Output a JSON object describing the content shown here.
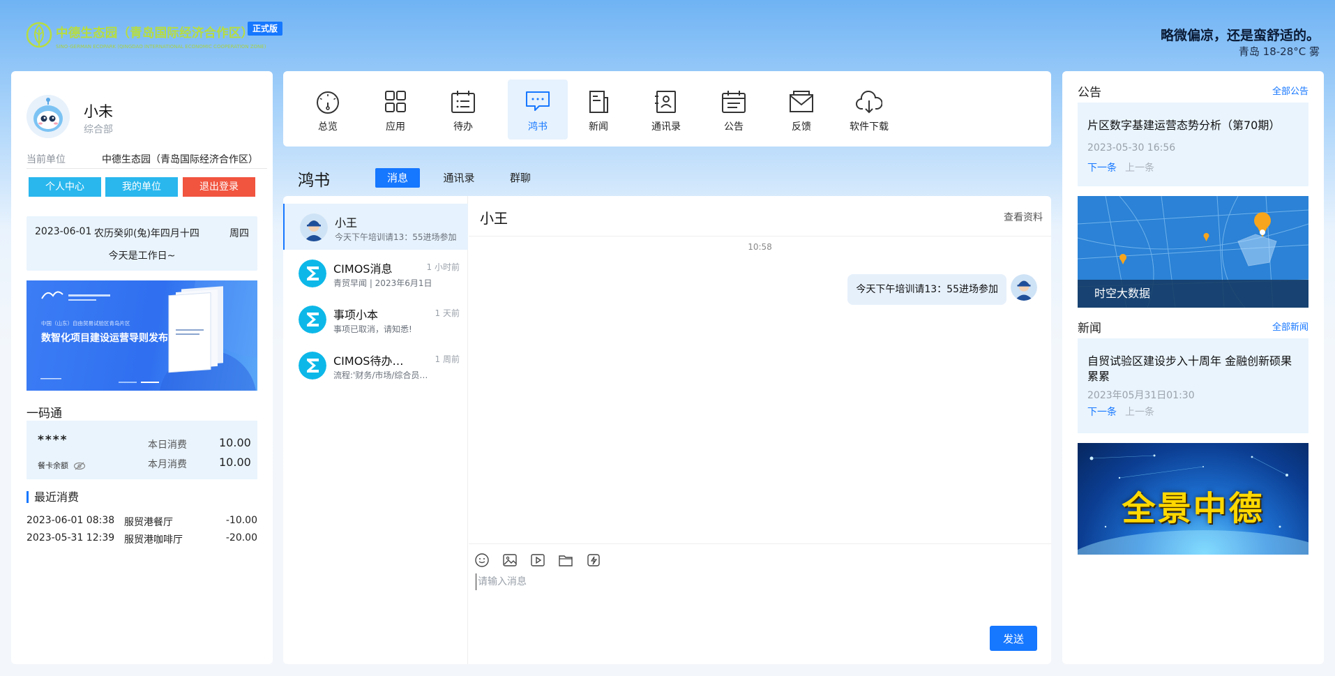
{
  "header": {
    "logo_title": "中德生态园（青岛国际经济合作区）",
    "logo_subtitle": "SINO-GERMAN ECOPARK (QINGDAO INTERNATIONAL ECONOMIC COOPERATION ZONE)",
    "version_badge": "正式版",
    "weather_text": "略微偏凉，还是蛮舒适的。",
    "weather_detail": "青岛 18-28°C 雾"
  },
  "profile": {
    "name": "小未",
    "department": "综合部",
    "unit_label": "当前单位",
    "unit_value": "中德生态园（青岛国际经济合作区）",
    "buttons": {
      "personal": "个人中心",
      "my_unit": "我的单位",
      "logout": "退出登录"
    }
  },
  "calendar": {
    "date": "2023-06-01",
    "lunar": "农历癸卯(兔)年四月十四",
    "weekday": "周四",
    "status": "今天是工作日~"
  },
  "banner": {
    "small_text": "中国（山东）自由贸易试验区青岛片区",
    "title": "数智化项目建设运营导则发布",
    "brand_color": "#2f6ff0"
  },
  "yimatong": {
    "title": "一码通",
    "card_mask": "****",
    "balance_label": "餐卡余额",
    "today_label": "本日消费",
    "today_value": "10.00",
    "month_label": "本月消费",
    "month_value": "10.00"
  },
  "recent": {
    "title": "最近消费",
    "items": [
      {
        "date": "2023-06-01 08:38",
        "merchant": "服贸港餐厅",
        "amount": "-10.00"
      },
      {
        "date": "2023-05-31 12:39",
        "merchant": "服贸港咖啡厅",
        "amount": "-20.00"
      }
    ]
  },
  "nav": {
    "items": [
      {
        "label": "总览",
        "icon": "gauge-icon"
      },
      {
        "label": "应用",
        "icon": "grid-icon"
      },
      {
        "label": "待办",
        "icon": "todo-calendar-icon"
      },
      {
        "label": "鸿书",
        "icon": "chat-bubble-icon"
      },
      {
        "label": "新闻",
        "icon": "newspaper-icon"
      },
      {
        "label": "通讯录",
        "icon": "contacts-icon"
      },
      {
        "label": "公告",
        "icon": "notice-calendar-icon"
      },
      {
        "label": "反馈",
        "icon": "envelope-icon"
      },
      {
        "label": "软件下载",
        "icon": "cloud-download-icon"
      }
    ],
    "active_index": 3,
    "accent_color": "#1677ff"
  },
  "hongshu": {
    "title": "鸿书",
    "tabs": [
      {
        "label": "消息"
      },
      {
        "label": "通讯录"
      },
      {
        "label": "群聊"
      }
    ]
  },
  "conversations": [
    {
      "name": "小王",
      "preview": "今天下午培训请13：55进场参加",
      "time": ""
    },
    {
      "name": "CIMOS消息",
      "preview": "青贸早闻 | 2023年6月1日",
      "time": "1 小时前"
    },
    {
      "name": "事项小本",
      "preview": "事项已取消，请知悉!",
      "time": "1 天前"
    },
    {
      "name": "CIMOS待办…",
      "preview": "流程:'财务/市场/综合员…",
      "time": "1 周前"
    }
  ],
  "chat": {
    "contact_name": "小王",
    "profile_link": "查看资料",
    "timestamp": "10:58",
    "message": "今天下午培训请13：55进场参加",
    "input_placeholder": "请输入消息",
    "send_label": "发送"
  },
  "notices": {
    "title": "公告",
    "more": "全部公告",
    "item_title": "片区数字基建运营态势分析（第70期）",
    "item_date": "2023-05-30 16:56",
    "next": "下一条",
    "prev": "上一条"
  },
  "map_card": {
    "caption": "时空大数据"
  },
  "news": {
    "title": "新闻",
    "more": "全部新闻",
    "item_title": "自贸试验区建设步入十周年 金融创新硕果累累",
    "item_date": "2023年05月31日01:30",
    "next": "下一条",
    "prev": "上一条"
  },
  "panorama": {
    "text": "全景中德"
  }
}
